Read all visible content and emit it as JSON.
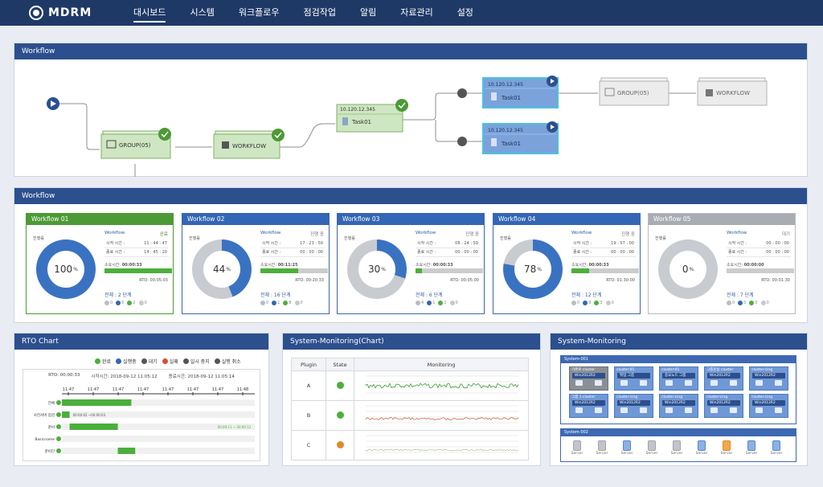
{
  "app": {
    "logo_text": "MDRM"
  },
  "nav": {
    "items": [
      "대시보드",
      "시스템",
      "워크플로우",
      "점검작업",
      "알림",
      "자료관리",
      "설정"
    ],
    "active": "대시보드"
  },
  "workflow_panel": {
    "title": "Workflow",
    "nodes": {
      "group1": "GROUP(05)",
      "workflow1": "WORKFLOW",
      "task_a_ip": "10.120.12.345",
      "task_a_name": "Task01",
      "task_b_ip": "10.120.12.345",
      "task_b_name": "Task01",
      "task_c_ip": "10.120.12.345",
      "task_c_name": "Task01",
      "group2": "GROUP(05)",
      "workflow2": "WORKFLOW"
    }
  },
  "workflow_cards_panel": {
    "title": "Workflow",
    "common": {
      "progress_label": "진행률",
      "type_label": "Workflow",
      "start_label": "시작 시간 :",
      "end_label": "종료 시간 :",
      "elapsed_label": "소요시간:",
      "rto_prefix": "RTO:"
    },
    "cards": [
      {
        "title": "Workflow 01",
        "percent": "100",
        "percent_value": 100,
        "status": "완료",
        "start": "11 : 44 : 47",
        "end": "14 : 45 : 20",
        "elapsed": "00:00:33",
        "rto": "00:05:03",
        "bar_fraction": 1.0,
        "total": "전체 : 2 단계",
        "counts": [
          "0",
          "0",
          "2",
          "0"
        ]
      },
      {
        "title": "Workflow 02",
        "percent": "44",
        "percent_value": 44,
        "status": "진행 중",
        "start": "17 : 23 : 50",
        "end": "00 : 00 : 00",
        "elapsed": "00:11:25",
        "rto": "00:20:33",
        "bar_fraction": 0.56,
        "total": "전체 : 16 단계",
        "counts": [
          "0",
          "1",
          "8",
          "0"
        ]
      },
      {
        "title": "Workflow 03",
        "percent": "30",
        "percent_value": 30,
        "status": "진행 중",
        "start": "08 : 24 : 59",
        "end": "00 : 00 : 00",
        "elapsed": "00:00:33",
        "rto": "00:05:00",
        "bar_fraction": 0.1,
        "total": "전체 : 6 단계",
        "counts": [
          "4",
          "1",
          "1",
          "0"
        ]
      },
      {
        "title": "Workflow 04",
        "percent": "78",
        "percent_value": 78,
        "status": "진행 중",
        "start": "19 : 57 : 00",
        "end": "00 : 00 : 00",
        "elapsed": "00:00:33",
        "rto": "01:30:00",
        "bar_fraction": 0.26,
        "total": "전체 : 12 단계",
        "counts": [
          "0",
          "9",
          "3",
          "0"
        ]
      },
      {
        "title": "Workflow 05",
        "percent": "0",
        "percent_value": 0,
        "status": "대기",
        "start": "00 : 00 : 00",
        "end": "00 : 00 : 00",
        "elapsed": "00:00:00",
        "rto": "00:01:30",
        "bar_fraction": 0,
        "total": "전체 : 7 단계",
        "counts": [
          "0",
          "0",
          "0",
          "0"
        ]
      }
    ]
  },
  "rto_chart": {
    "title": "RTO Chart",
    "legend": [
      "완료",
      "실행중",
      "대기",
      "실패",
      "일시 중지",
      "실행 취소"
    ],
    "legend_colors": [
      "#4caf3b",
      "#3366b4",
      "#555555",
      "#e04a3b",
      "#555555",
      "#555555"
    ],
    "rto_text": "RTO: 00:00:33",
    "start_text": "시작시간: 2018-09-12 11:05:12",
    "end_text": "종료시간: 2018-09-12 11:05:14",
    "ticks": [
      "11:47",
      "11:47",
      "11:47",
      "11:47",
      "11:47",
      "11:47",
      "11:47",
      "11:48"
    ],
    "rows": [
      {
        "label": "전체",
        "start": 0.0,
        "end": 0.36
      },
      {
        "label": "사전서버 점검",
        "start": 0.0,
        "end": 0.04,
        "note": "00:00:02 ~00:00:03"
      },
      {
        "label": "준비",
        "start": 0.04,
        "end": 0.29,
        "note": "00:00:11 ~ 00:00:12"
      },
      {
        "label": "Basicname",
        "start": 0.29,
        "end": 0.29
      },
      {
        "label": "준비단",
        "start": 0.29,
        "end": 0.38
      }
    ]
  },
  "monitoring_chart": {
    "title": "System-Monitoring(Chart)",
    "headers": [
      "Plugin",
      "State",
      "Monitoring"
    ],
    "rows": [
      {
        "plugin": "A",
        "state_color": "#4caf3b"
      },
      {
        "plugin": "B",
        "state_color": "#4caf3b"
      },
      {
        "plugin": "C",
        "state_color": "#e08a2c"
      }
    ]
  },
  "system_monitoring": {
    "title": "System-Monitoring",
    "box1_title": "System-001",
    "tiles": [
      {
        "title": "기존로 cluster",
        "badge": "Win2012R2",
        "gray": true
      },
      {
        "title": "cluster-01",
        "badge": "백업 그룹",
        "gray": false
      },
      {
        "title": "cluster-01",
        "badge": "중요노드 그룹",
        "gray": false
      },
      {
        "title": "그룹운용 cluster",
        "badge": "Win2012R2",
        "gray": false
      },
      {
        "title": "cluster-cing",
        "badge": "Win2012R2",
        "gray": false
      },
      {
        "title": "그룹 1 cluster",
        "badge": "Win2012R2",
        "gray": false
      },
      {
        "title": "cluster-cing",
        "badge": "Win2012R2",
        "gray": false
      },
      {
        "title": "cluster-cing",
        "badge": "Win2012R2",
        "gray": false
      },
      {
        "title": "cluster-cing",
        "badge": "Win2012R2",
        "gray": false
      },
      {
        "title": "cluster-cing",
        "badge": "Win2012R2",
        "gray": false
      }
    ],
    "box2_title": "System-002",
    "servers": [
      {
        "name": "Server",
        "color": "gray"
      },
      {
        "name": "Server",
        "color": "gray"
      },
      {
        "name": "Server",
        "color": "blue"
      },
      {
        "name": "Server",
        "color": "gray"
      },
      {
        "name": "Server",
        "color": "gray"
      },
      {
        "name": "Server",
        "color": "blue"
      },
      {
        "name": "Server",
        "color": "orange"
      },
      {
        "name": "Server",
        "color": "blue"
      },
      {
        "name": "Server",
        "color": "blue"
      }
    ]
  }
}
